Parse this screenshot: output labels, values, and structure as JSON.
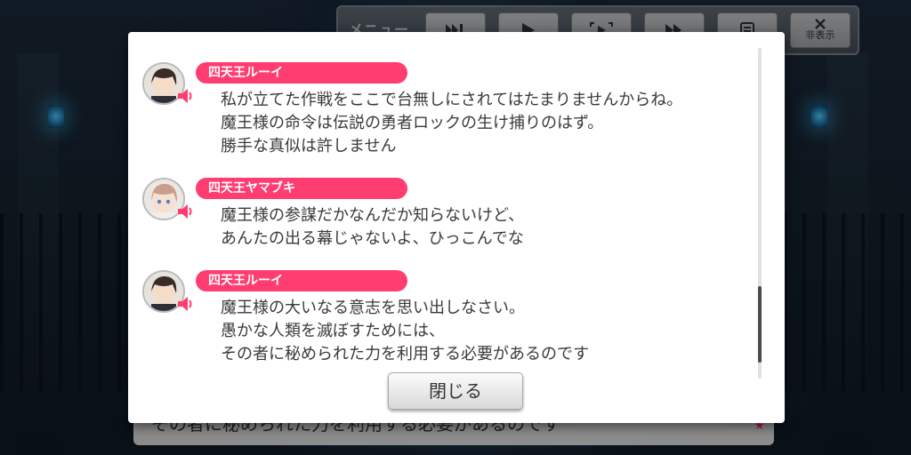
{
  "toolbar": {
    "menu_label": "メニュー",
    "buttons": [
      {
        "icon": "skip-icon"
      },
      {
        "icon": "play-icon"
      },
      {
        "icon": "auto-icon"
      },
      {
        "icon": "fast-forward-icon"
      },
      {
        "icon": "log-icon"
      },
      {
        "icon": "hide-icon",
        "label": "非表示"
      }
    ]
  },
  "bottom_dialog": {
    "text": "その者に秘められた力を利用する必要があるのです"
  },
  "log": {
    "entries": [
      {
        "speaker": "四天王ルーイ",
        "lines": [
          "私が立てた作戦をここで台無しにされてはたまりませんからね。",
          "魔王様の命令は伝説の勇者ロックの生け捕りのはず。",
          "勝手な真似は許しません"
        ]
      },
      {
        "speaker": "四天王ヤマブキ",
        "lines": [
          "魔王様の参謀だかなんだか知らないけど、",
          "あんたの出る幕じゃないよ、ひっこんでな"
        ]
      },
      {
        "speaker": "四天王ルーイ",
        "lines": [
          "魔王様の大いなる意志を思い出しなさい。",
          "愚かな人類を滅ぼすためには、",
          "その者に秘められた力を利用する必要があるのです"
        ]
      }
    ],
    "close_label": "閉じる"
  },
  "colors": {
    "name_pill": "#ff3d71",
    "modal_bg": "#ffffff",
    "text": "#3a3a3a"
  }
}
